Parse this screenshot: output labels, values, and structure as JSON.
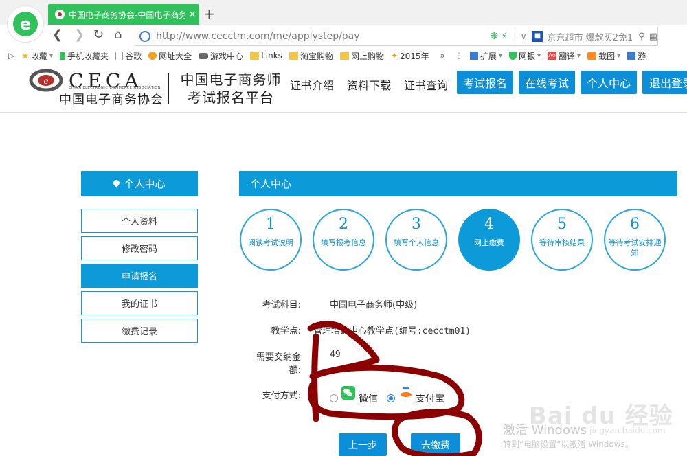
{
  "browser": {
    "tab_title": "中国电子商务协会-中国电子商务",
    "tab_close": "×",
    "new_tab": "+",
    "url": "http://www.cecctm.com/me/applystep/pay",
    "search_text": "京东超市 爆款买2免1",
    "bookmarks": [
      {
        "icon": "star",
        "label": "收藏",
        "dropdown": true
      },
      {
        "icon": "phone",
        "label": "手机收藏夹"
      },
      {
        "icon": "doc",
        "label": "谷歌"
      },
      {
        "icon": "globe",
        "label": "网址大全"
      },
      {
        "icon": "pad",
        "label": "游戏中心"
      },
      {
        "icon": "folder",
        "label": "Links"
      },
      {
        "icon": "folder",
        "label": "淘宝购物"
      },
      {
        "icon": "folder",
        "label": "网上购物"
      },
      {
        "icon": "bolt",
        "label": "2015年"
      }
    ],
    "bookmarks_more": "»",
    "tools": [
      {
        "icon": "square",
        "label": "扩展"
      },
      {
        "icon": "shield",
        "label": "网银"
      },
      {
        "icon": "ao",
        "label": "翻译"
      },
      {
        "icon": "scissor",
        "label": "截图"
      },
      {
        "icon": "square",
        "label": "游"
      }
    ]
  },
  "site": {
    "logo_text": "CECA",
    "logo_sub": "CHINA ELECTRONIC COMMERCE ASSOCIATION",
    "logo_cn": "中国电子商务协会",
    "platform_line1": "中国电子商务师",
    "platform_line2": "考试报名平台",
    "nav_links": [
      "证书介绍",
      "资料下载",
      "证书查询"
    ],
    "nav_buttons": [
      "考试报名",
      "在线考试",
      "个人中心",
      "退出登录"
    ]
  },
  "sidebar": {
    "title": "个人中心",
    "items": [
      "个人资料",
      "修改密码",
      "申请报名",
      "我的证书",
      "缴费记录"
    ],
    "active_index": 2
  },
  "main": {
    "title": "个人中心",
    "steps": [
      {
        "num": "1",
        "label": "阅读考试说明"
      },
      {
        "num": "2",
        "label": "填写报考信息"
      },
      {
        "num": "3",
        "label": "填写个人信息"
      },
      {
        "num": "4",
        "label": "网上缴费"
      },
      {
        "num": "5",
        "label": "等待审核结果"
      },
      {
        "num": "6",
        "label": "等待考试安排通知"
      }
    ],
    "active_step": 3,
    "form": {
      "subject_label": "考试科目:",
      "subject_value": "中国电子商务师(中级)",
      "center_label": "教学点:",
      "center_value": "管理培训中心教学点(编号:cecctm01)",
      "amount_label_1": "需要交纳金",
      "amount_label_2": "额:",
      "amount_value": "49",
      "payment_label": "支付方式:",
      "payment_options": [
        {
          "label": "微信",
          "icon": "wechat-icon",
          "selected": false
        },
        {
          "label": "支付宝",
          "icon": "alipay-icon",
          "selected": true
        }
      ]
    },
    "buttons": {
      "prev": "上一步",
      "pay": "去缴费"
    }
  },
  "overlay": {
    "activate_title": "激活 Windows",
    "activate_sub": "转到“电脑设置”以激活 Windows。",
    "baidu_logo": "Bai du 经验",
    "baidu_url": "jingyan.baidu.com",
    "scribble_color": "#8b0000"
  }
}
